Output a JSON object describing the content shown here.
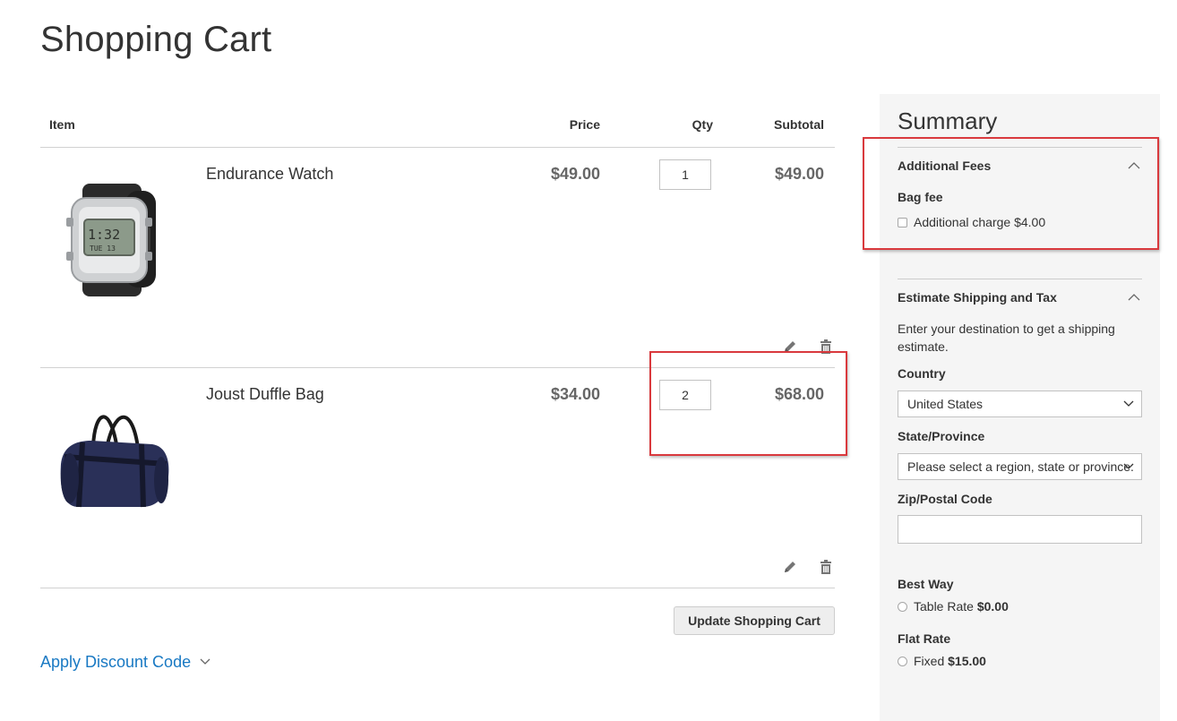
{
  "page": {
    "title": "Shopping Cart"
  },
  "table": {
    "headers": {
      "item": "Item",
      "price": "Price",
      "qty": "Qty",
      "subtotal": "Subtotal"
    },
    "rows": [
      {
        "name": "Endurance Watch",
        "price": "$49.00",
        "qty": "1",
        "subtotal": "$49.00",
        "image_icon": "wristwatch-image"
      },
      {
        "name": "Joust Duffle Bag",
        "price": "$34.00",
        "qty": "2",
        "subtotal": "$68.00",
        "image_icon": "duffle-bag-image"
      }
    ]
  },
  "actions": {
    "update_label": "Update Shopping Cart",
    "discount_label": "Apply Discount Code"
  },
  "summary": {
    "title": "Summary",
    "fees": {
      "heading": "Additional Fees",
      "group": "Bag fee",
      "option_label": "Additional charge ",
      "option_amount": "$4.00"
    },
    "shipping": {
      "heading": "Estimate Shipping and Tax",
      "description": "Enter your destination to get a shipping estimate.",
      "country_label": "Country",
      "country_value": "United States",
      "state_label": "State/Province",
      "state_value": "Please select a region, state or province.",
      "zip_label": "Zip/Postal Code",
      "zip_value": "",
      "methods": [
        {
          "carrier": "Best Way",
          "option": "Table Rate",
          "amount": "$0.00"
        },
        {
          "carrier": "Flat Rate",
          "option": "Fixed",
          "amount": "$15.00"
        }
      ]
    }
  },
  "colors": {
    "link": "#1979c3",
    "highlight": "#d9393d",
    "summary_bg": "#f5f5f5"
  }
}
